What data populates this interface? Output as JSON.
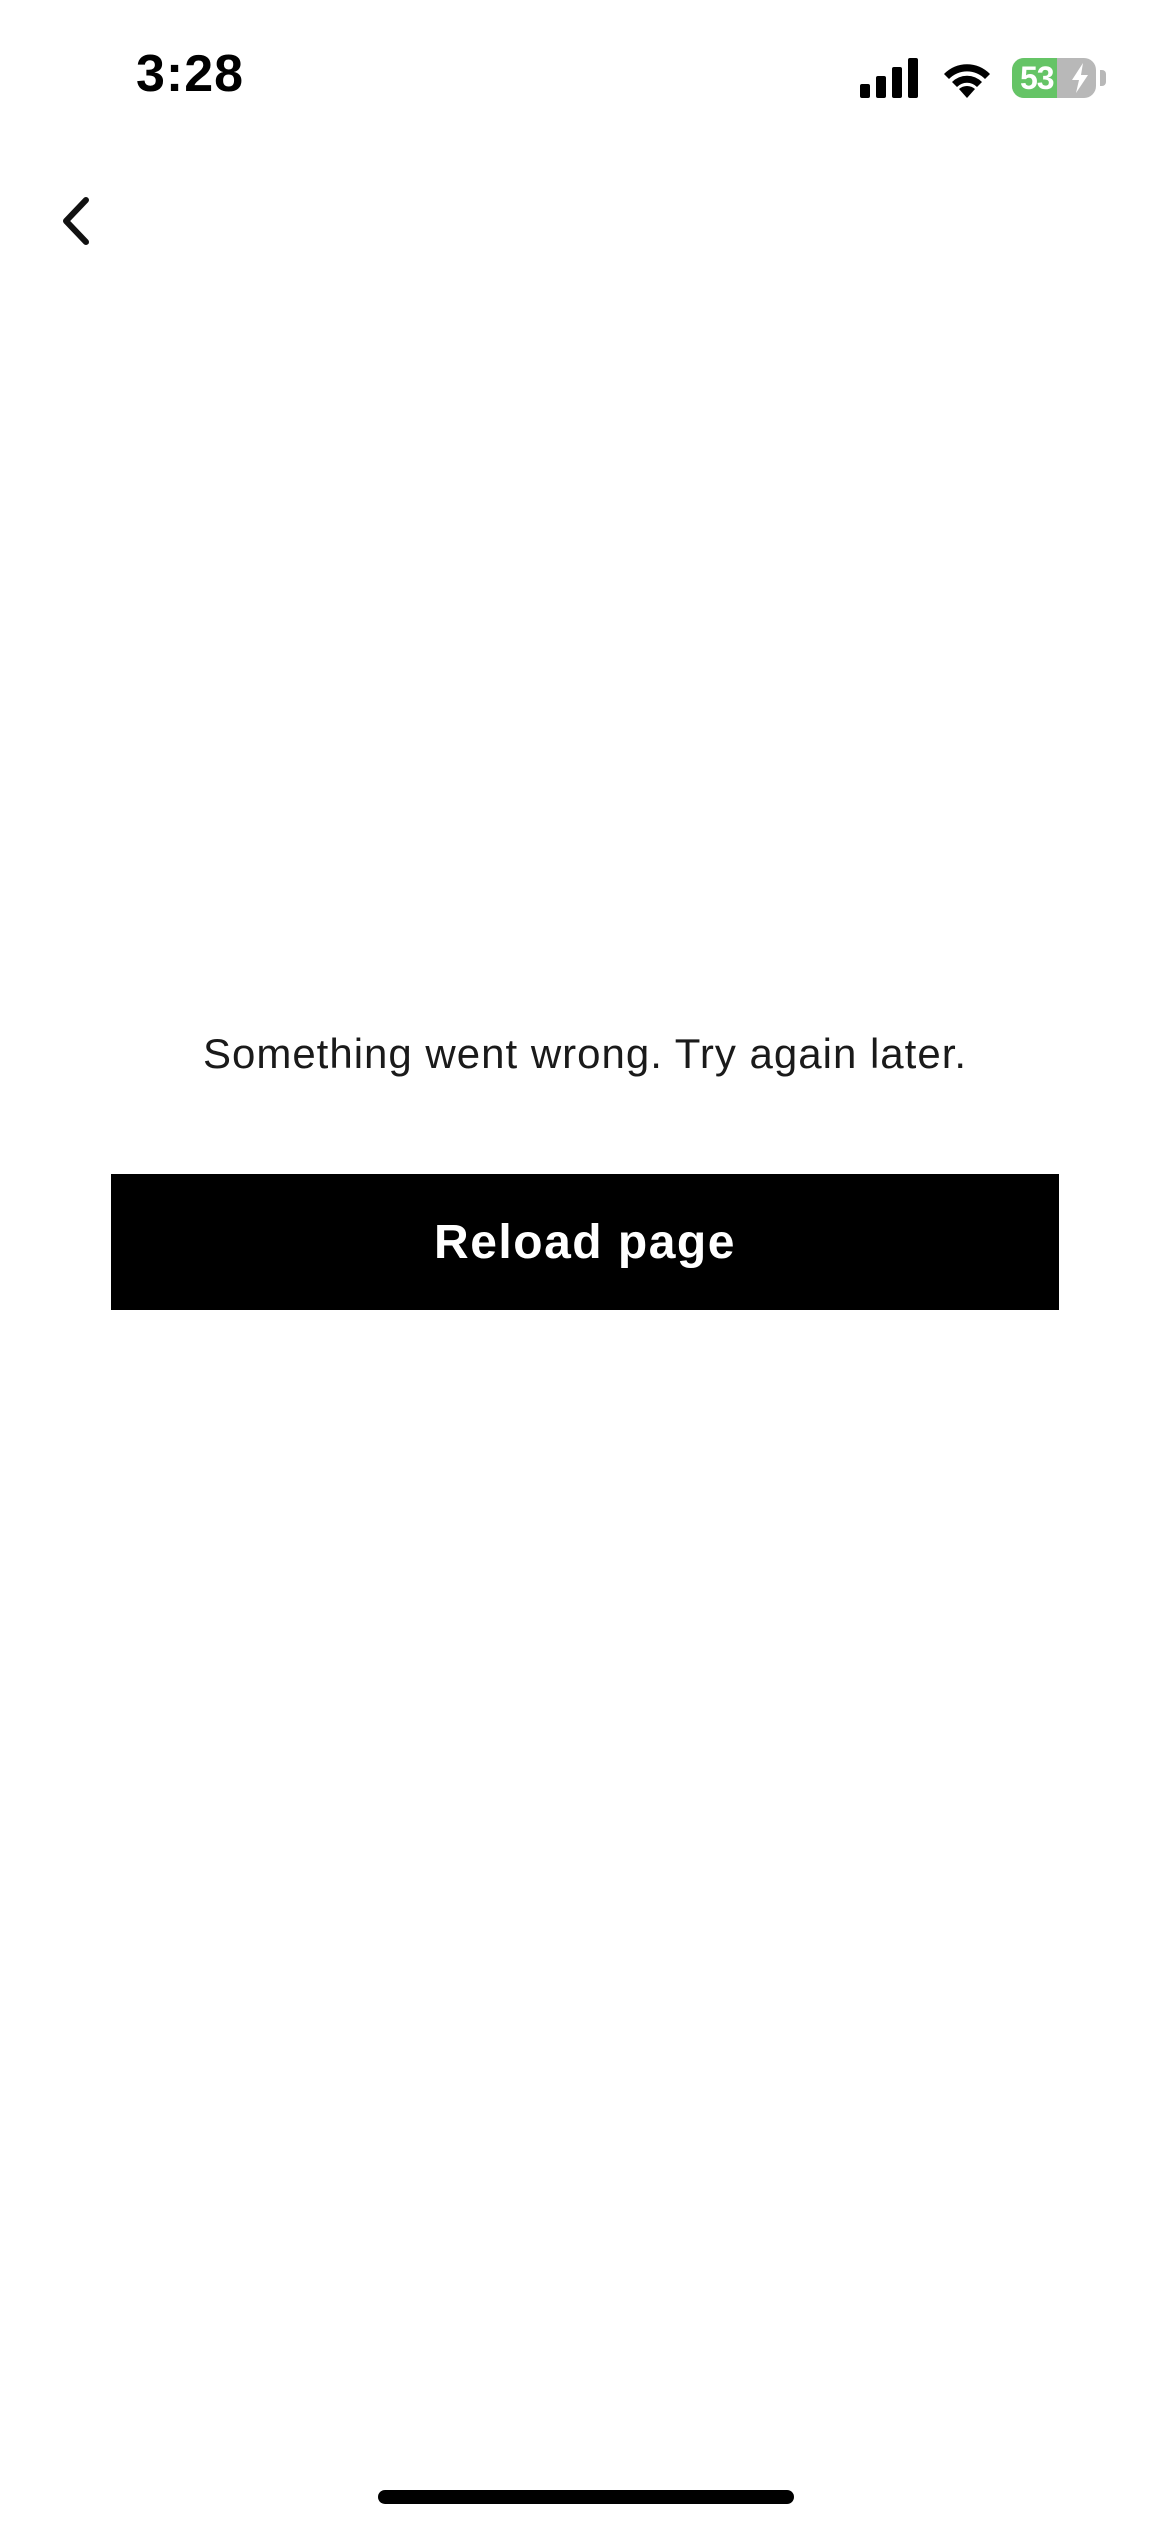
{
  "status_bar": {
    "time": "3:28",
    "battery_level": "53",
    "battery_fraction": 0.53,
    "battery_charging": true,
    "battery_color": "#65c466",
    "icons": [
      "signal-icon",
      "wifi-icon",
      "battery-icon",
      "charging-bolt-icon"
    ]
  },
  "nav": {
    "back_icon": "chevron-left-icon"
  },
  "main": {
    "error_message": "Something went wrong. Try again later.",
    "reload_label": "Reload page",
    "button_color": "#000000"
  }
}
